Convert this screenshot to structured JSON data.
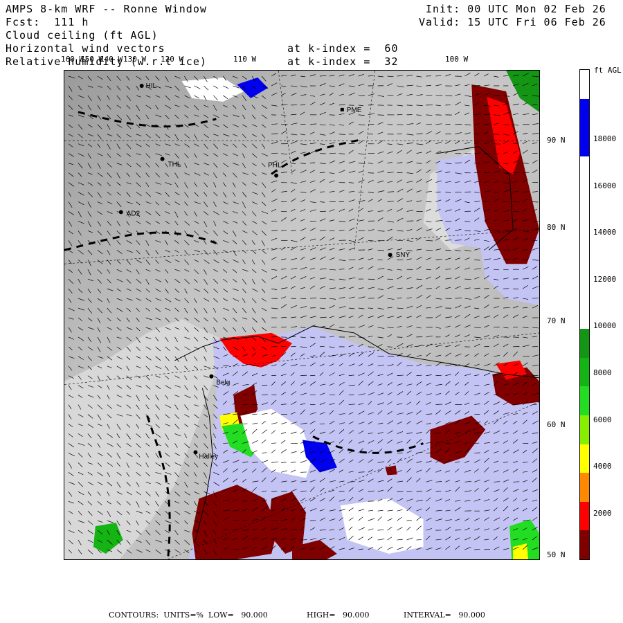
{
  "header": {
    "line1": "AMPS 8-km WRF -- Ronne Window",
    "line2": "Fcst:  111 h",
    "line3": "Cloud ceiling (ft AGL)",
    "line4": "Horizontal wind vectors",
    "line5": "Relative humidity (w.r.t ice)",
    "k1": "at k-index =  60",
    "k2": "at k-index =  32",
    "init": "Init: 00 UTC Mon 02 Feb 26",
    "valid": "Valid: 15 UTC Fri 06 Feb 26"
  },
  "lon_labels": [
    "160 W",
    "150 W",
    "140 W",
    "130 W",
    "120 W",
    "110 W",
    "100 W"
  ],
  "lat_labels": [
    "90 N",
    "80 N",
    "70 N",
    "60 N",
    "50 N"
  ],
  "stations": [
    "HIL",
    "PME",
    "THL",
    "PHL",
    "AD2",
    "SNY",
    "Belg",
    "Halley"
  ],
  "colorbar": {
    "title": "ft AGL",
    "labels": [
      "18000",
      "16000",
      "14000",
      "12000",
      "10000",
      "8000",
      "6000",
      "4000",
      "2000"
    ],
    "colors": [
      "#ffffff",
      "#0000ee",
      "#0000ee",
      "#ffffff",
      "#ffffff",
      "#ffffff",
      "#ffffff",
      "#ffffff",
      "#ffffff",
      "#149614",
      "#14b414",
      "#22dd22",
      "#88ee00",
      "#ffff00",
      "#ff8800",
      "#ff0000",
      "#800000"
    ]
  },
  "footer": {
    "contours": "CONTOURS:  UNITS=%  LOW=   90.000",
    "high": "HIGH=   90.000",
    "interval": "INTERVAL=   90.000"
  }
}
